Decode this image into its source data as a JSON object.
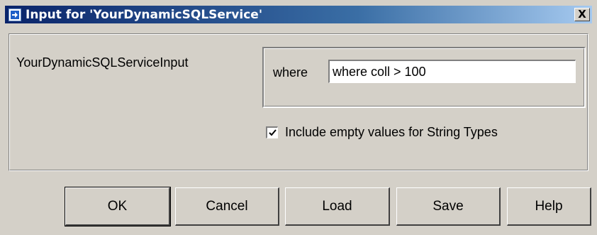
{
  "window": {
    "title": "Input for 'YourDynamicSQLService'",
    "close_label": "X"
  },
  "form": {
    "service_input_label": "YourDynamicSQLServiceInput",
    "where_label": "where",
    "where_value": "where coll > 100",
    "include_empty_label": "Include empty values for String Types",
    "include_empty_checked": true
  },
  "buttons": {
    "ok": "OK",
    "cancel": "Cancel",
    "load": "Load",
    "save": "Save",
    "help": "Help"
  },
  "colors": {
    "face": "#d4d0c8",
    "title_start": "#0a246a",
    "title_end": "#a6caf0"
  },
  "icons": {
    "title": "arrow-right-icon",
    "close": "close-icon",
    "check": "checkmark-icon"
  }
}
